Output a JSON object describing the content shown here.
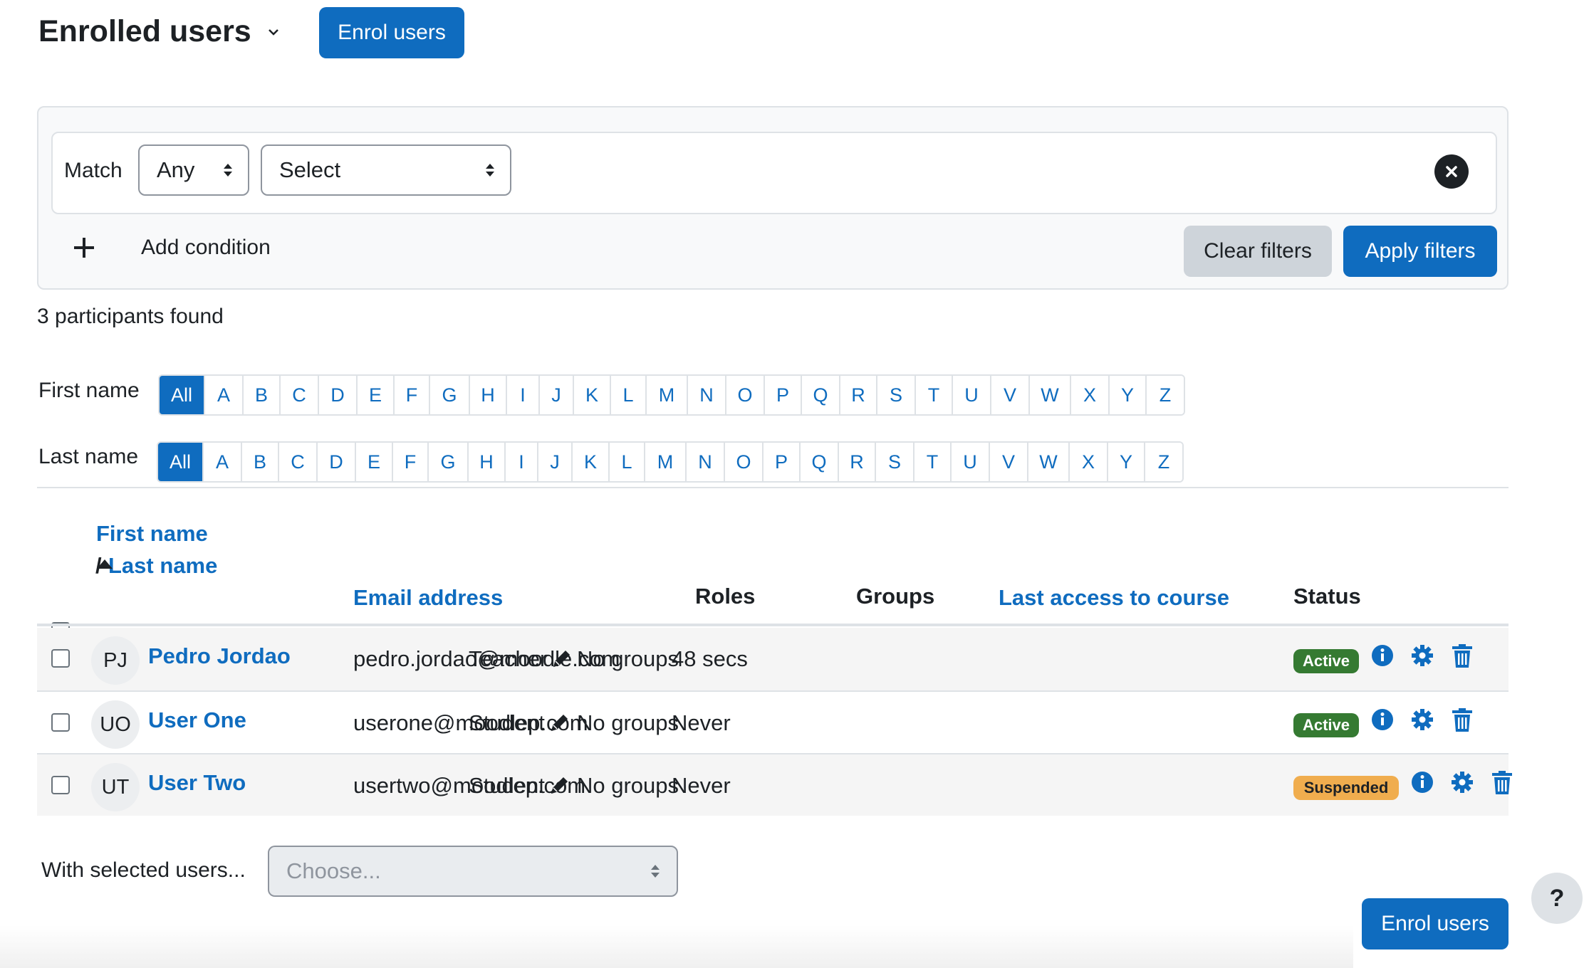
{
  "header": {
    "title": "Enrolled users",
    "enrol_button": "Enrol users"
  },
  "filter": {
    "match_label": "Match",
    "match_value": "Any",
    "type_value": "Select",
    "add_condition": "Add condition",
    "clear_button": "Clear filters",
    "apply_button": "Apply filters"
  },
  "participants_found": "3 participants found",
  "initials": {
    "first_label": "First name",
    "last_label": "Last name",
    "letters": [
      "All",
      "A",
      "B",
      "C",
      "D",
      "E",
      "F",
      "G",
      "H",
      "I",
      "J",
      "K",
      "L",
      "M",
      "N",
      "O",
      "P",
      "Q",
      "R",
      "S",
      "T",
      "U",
      "V",
      "W",
      "X",
      "Y",
      "Z"
    ]
  },
  "table": {
    "headers": {
      "first_name": "First name",
      "last_name": "Last name",
      "name_separator": "/",
      "email": "Email address",
      "roles": "Roles",
      "groups": "Groups",
      "last_access": "Last access to course",
      "status": "Status"
    },
    "rows": [
      {
        "initials": "PJ",
        "name": "Pedro Jordao",
        "email": "pedro.jordao@moodle.com",
        "role": "Teacher",
        "groups": "No groups",
        "last_access": "48 secs",
        "status": "Active"
      },
      {
        "initials": "UO",
        "name": "User One",
        "email": "userone@moodlep.com",
        "role": "Student",
        "groups": "No groups",
        "last_access": "Never",
        "status": "Active"
      },
      {
        "initials": "UT",
        "name": "User Two",
        "email": "usertwo@moodlep.com",
        "role": "Student",
        "groups": "No groups",
        "last_access": "Never",
        "status": "Suspended"
      }
    ]
  },
  "bulk": {
    "label": "With selected users...",
    "placeholder": "Choose..."
  },
  "footer": {
    "enrol_button": "Enrol users",
    "help": "?"
  },
  "colors": {
    "primary": "#0f6cbf",
    "active_badge": "#357a32",
    "suspended_badge": "#f0ad4e"
  }
}
